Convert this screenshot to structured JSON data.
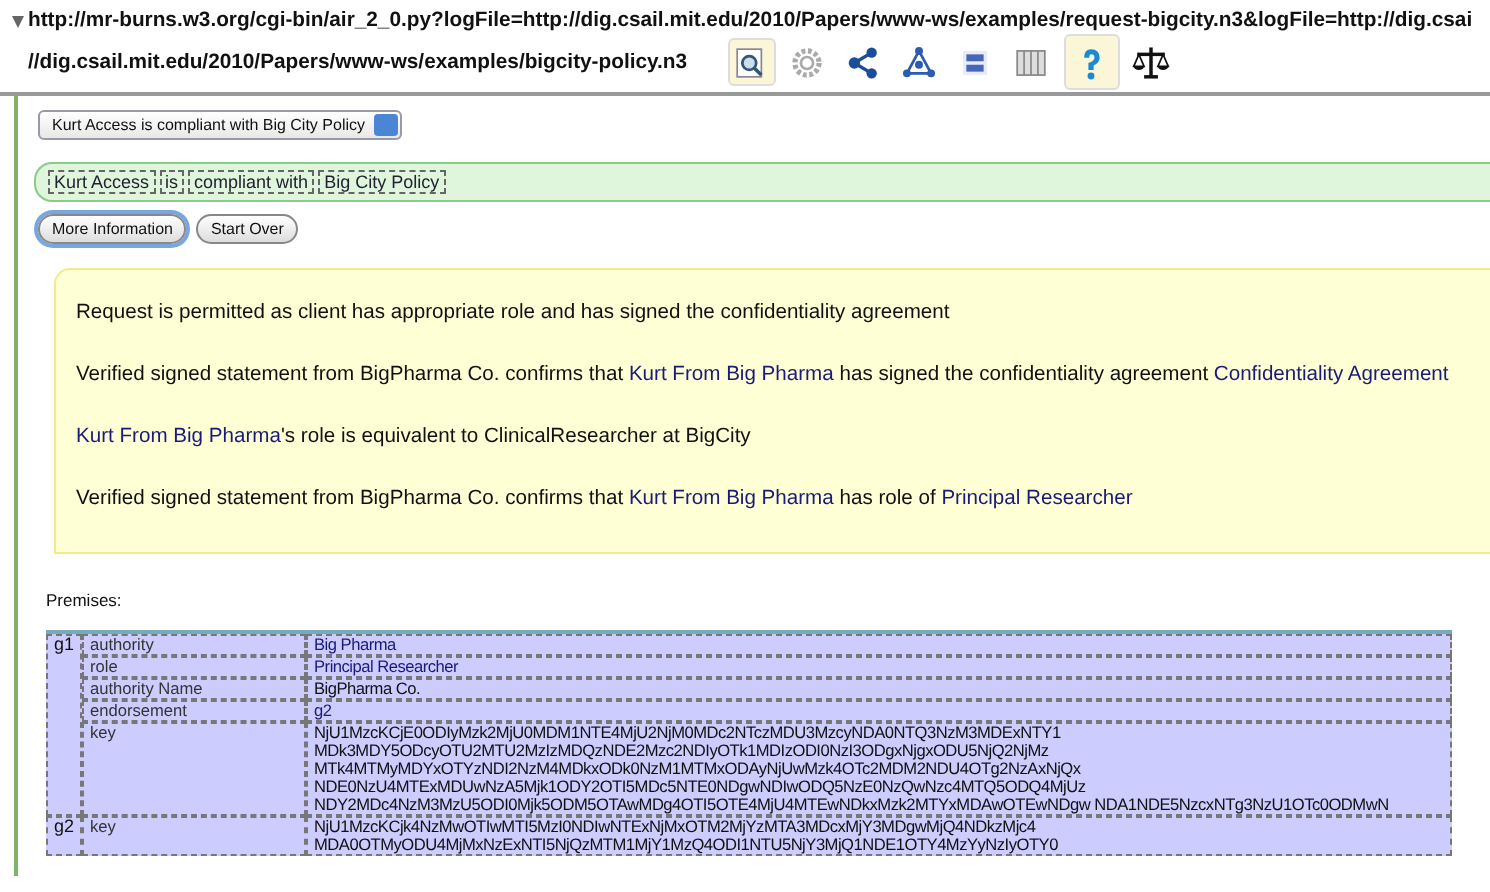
{
  "address": {
    "line_1": "http://mr-burns.w3.org/cgi-bin/air_2_0.py?logFile=http://dig.csail.mit.edu/2010/Papers/www-ws/examples/request-bigcity.n3&logFile=http://dig.csai",
    "line_2": "//dig.csail.mit.edu/2010/Papers/www-ws/examples/bigcity-policy.n3"
  },
  "toolbar": [
    {
      "kind": "inspect",
      "selected": true
    },
    {
      "kind": "gear",
      "selected": false
    },
    {
      "kind": "share",
      "selected": false
    },
    {
      "kind": "graph",
      "selected": false
    },
    {
      "kind": "rdf",
      "selected": false
    },
    {
      "kind": "columns",
      "selected": false
    },
    {
      "kind": "help",
      "selected": true
    },
    {
      "kind": "scales",
      "selected": false
    }
  ],
  "conclusion_select": {
    "value": "Kurt Access is compliant with Big City Policy"
  },
  "conclusion_terms": [
    "Kurt Access",
    "is",
    "compliant with",
    "Big City Policy"
  ],
  "buttons": [
    {
      "label": "More Information",
      "focused": true
    },
    {
      "label": "Start Over",
      "focused": false
    }
  ],
  "explanation": [
    [
      {
        "text": "Request is permitted as client has appropriate role and has signed the confidentiality agreement",
        "link": false
      }
    ],
    [
      {
        "text": "Verified signed statement from BigPharma Co. confirms that ",
        "link": false
      },
      {
        "text": "Kurt From Big Pharma",
        "link": true
      },
      {
        "text": " has signed the confidentiality agreement ",
        "link": false
      },
      {
        "text": "Confidentiality Agreement",
        "link": true
      }
    ],
    [
      {
        "text": "Kurt From Big Pharma",
        "link": true
      },
      {
        "text": "'s role is equivalent to ClinicalResearcher at BigCity",
        "link": false
      }
    ],
    [
      {
        "text": "Verified signed statement from BigPharma Co. confirms that ",
        "link": false
      },
      {
        "text": "Kurt From Big Pharma",
        "link": true
      },
      {
        "text": " has role of ",
        "link": false
      },
      {
        "text": "Principal Researcher",
        "link": true
      }
    ]
  ],
  "premises": {
    "label": "Premises:",
    "graphs": [
      {
        "name": "g1",
        "rows": [
          {
            "property": "authority",
            "value_lines": [
              "Big Pharma"
            ],
            "link": true
          },
          {
            "property": "role",
            "value_lines": [
              "Principal Researcher"
            ],
            "link": true
          },
          {
            "property": "authority Name",
            "value_lines": [
              "BigPharma Co."
            ],
            "link": false
          },
          {
            "property": "endorsement",
            "value_lines": [
              "g2"
            ],
            "link": true
          },
          {
            "property": "key",
            "value_lines": [
              "NjU1MzcKCjE0ODIyMzk2MjU0MDM1NTE4MjU2NjM0MDc2NTczMDU3MzcyNDA0NTQ3NzM3MDExNTY1",
              "MDk3MDY5ODcyOTU2MTU2MzIzMDQzNDE2Mzc2NDIyOTk1MDIzODI0NzI3ODgxNjgxODU5NjQ2NjMz",
              "MTk4MTMyMDYxOTYzNDI2NzM4MDkxODk0NzM1MTMxODAyNjUwMzk4OTc2MDM2NDU4OTg2NzAxNjQx",
              "NDE0NzU4MTExMDUwNzA5Mjk1ODY2OTI5MDc5NTE0NDgwNDIwODQ5NzE0NzQwNzc4MTQ5ODQ4MjUz",
              "NDY2MDc4NzM3MzU5ODI0Mjk5ODM5OTAwMDg4OTI5OTE4MjU4MTEwNDkxMzk2MTYxMDAwOTEwNDgw NDA1NDE5NzcxNTg3NzU1OTc0ODMwN"
            ],
            "link": false
          }
        ]
      },
      {
        "name": "g2",
        "rows": [
          {
            "property": "key",
            "value_lines": [
              "NjU1MzcKCjk4NzMwOTIwMTI5MzI0NDIwNTExNjMxOTM2MjYzMTA3MDcxMjY3MDgwMjQ4NDkzMjc4",
              "MDA0OTMyODU4MjMxNzExNTI5NjQzMTM1MjY1MzQ4ODI1NTU5NjY3MjQ1NDE1OTY4MzYyNzIyOTY0"
            ],
            "link": false
          }
        ]
      }
    ]
  }
}
